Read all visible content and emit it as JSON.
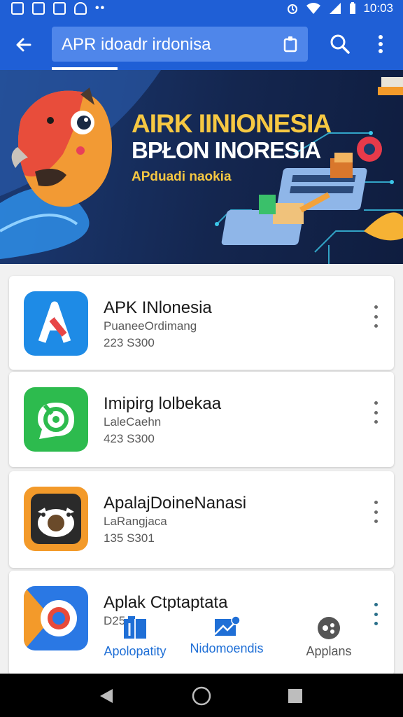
{
  "status_bar": {
    "time": "10:03"
  },
  "app_bar": {
    "search_text": "APR  idoadr irdonisa"
  },
  "banner": {
    "title": "AIRK IINIONESIA",
    "subtitle": "BPŁON INORESIA",
    "tagline": "APduadi naokia"
  },
  "apps": [
    {
      "name": "APK INlonesia",
      "developer": "PuaneeOrdimang",
      "count": "223 S300",
      "icon": "apk-a-icon"
    },
    {
      "name": "Imipirg lolbekaa",
      "developer": "LaleCaehn",
      "count": "423 S300",
      "icon": "chat-target-icon"
    },
    {
      "name": "ApalajDoineNanasi",
      "developer": "LaRangjaca",
      "count": "135 S301",
      "icon": "cow-face-icon"
    },
    {
      "name": "Aplak Ctptaptata",
      "developer": "D25",
      "count": "",
      "icon": "target-play-icon"
    }
  ],
  "bottom_tabs": [
    {
      "label": "Apolopatity",
      "icon": "book-icon",
      "color": "#1f6fd6"
    },
    {
      "label": "Nidomoendis",
      "icon": "mail-icon",
      "color": "#1f6fd6"
    },
    {
      "label": "Applans",
      "icon": "apps-circle-icon",
      "color": "#555555"
    }
  ],
  "colors": {
    "primary": "#1f5fd6",
    "search_field": "#4f86ea",
    "banner_gold": "#f6c842"
  }
}
